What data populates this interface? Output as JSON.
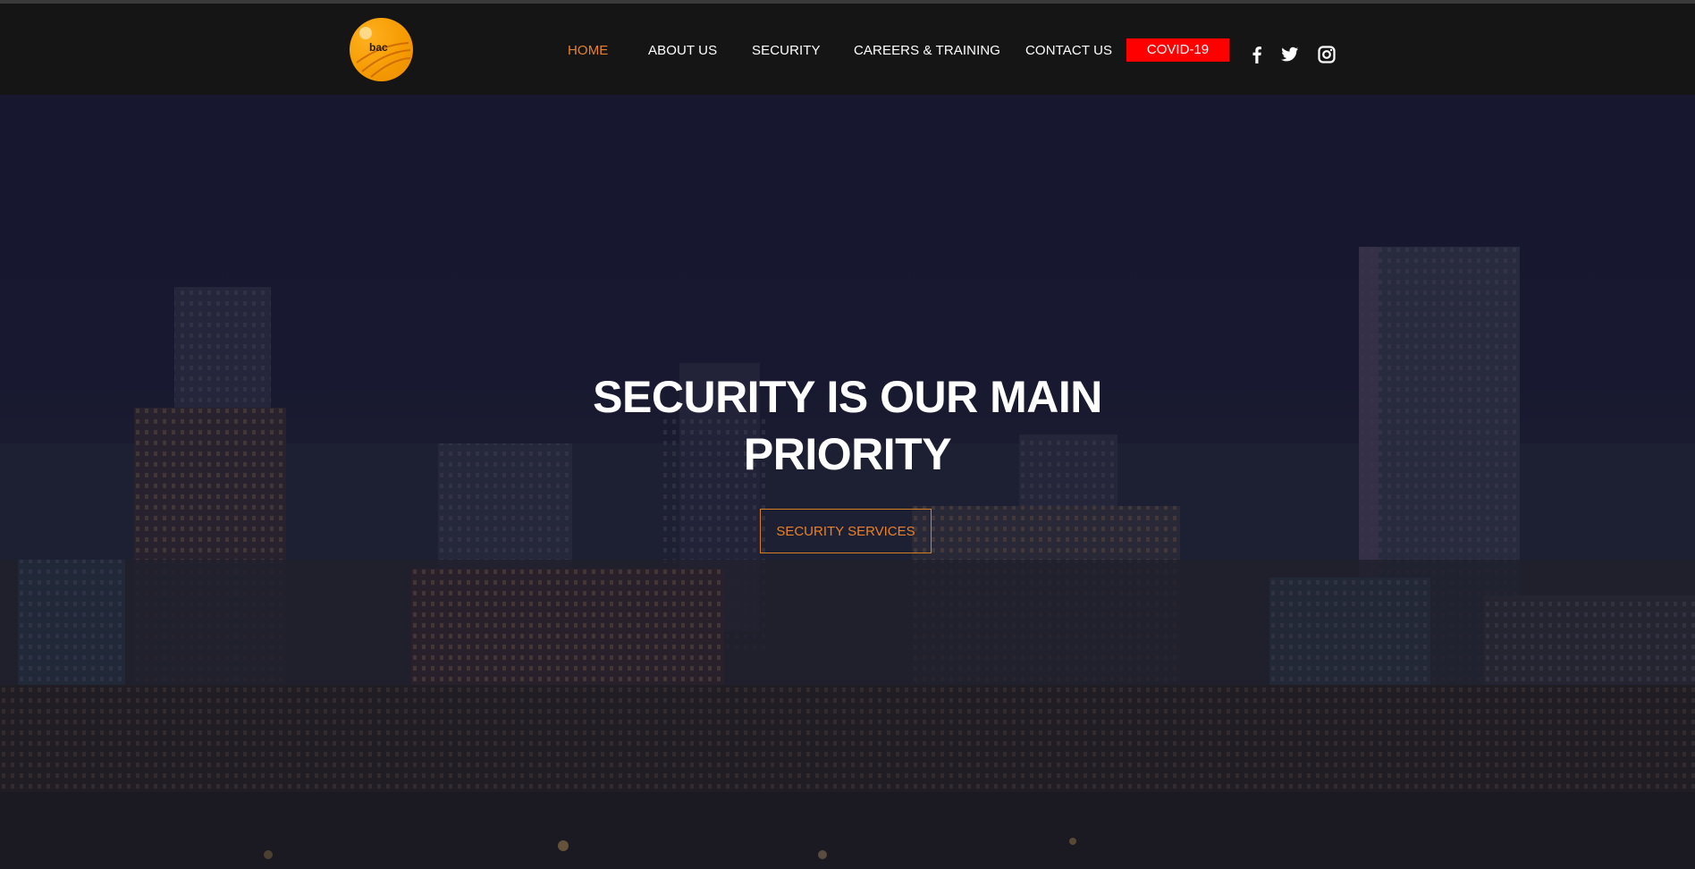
{
  "brand": {
    "logo_text": "bac",
    "accent": "#e8822a",
    "logo_color": "#f59a00"
  },
  "nav": {
    "items": [
      {
        "label": "HOME",
        "active": true
      },
      {
        "label": "ABOUT US",
        "active": false
      },
      {
        "label": "SECURITY",
        "active": false
      },
      {
        "label": "CAREERS & TRAINING",
        "active": false
      },
      {
        "label": "CONTACT US",
        "active": false
      }
    ],
    "covid_label": "COVID-19",
    "covid_color": "#ff0000"
  },
  "social": [
    "facebook-icon",
    "twitter-icon",
    "instagram-icon"
  ],
  "hero": {
    "title_line1": "SECURITY IS OUR MAIN",
    "title_line2": "PRIORITY",
    "button_label": "SECURITY SERVICES"
  }
}
